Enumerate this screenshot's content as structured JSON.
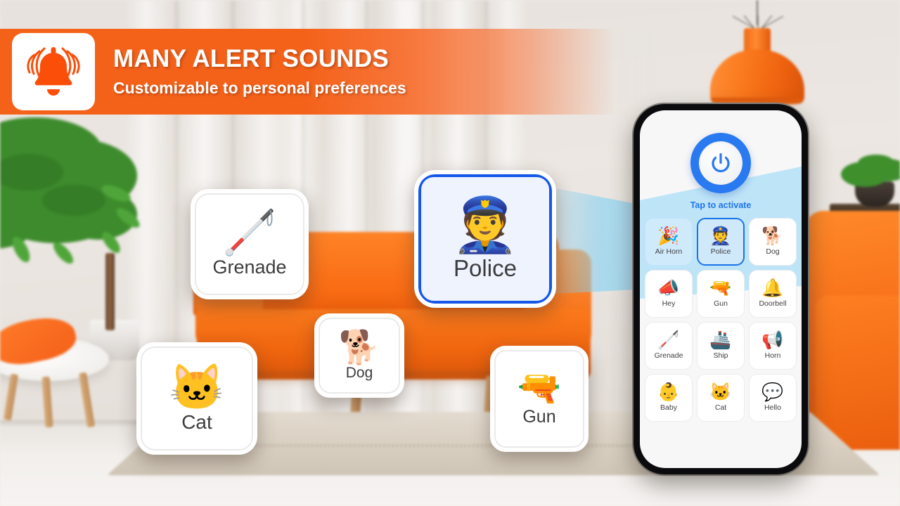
{
  "banner": {
    "icon": "alarm-bell-icon",
    "title": "MANY ALERT SOUNDS",
    "subtitle": "Customizable to personal preferences",
    "bg_color": "#f4621a",
    "text_color": "#ffffff"
  },
  "floating_cards": [
    {
      "id": "grenade",
      "label": "Grenade",
      "emoji": "🦯",
      "icon": "grenade-icon",
      "selected": false
    },
    {
      "id": "police",
      "label": "Police",
      "emoji": "👮",
      "icon": "police-officer-icon",
      "selected": true
    },
    {
      "id": "dog",
      "label": "Dog",
      "emoji": "🐕",
      "icon": "dog-icon",
      "selected": false
    },
    {
      "id": "cat",
      "label": "Cat",
      "emoji": "🐱",
      "icon": "cat-icon",
      "selected": false
    },
    {
      "id": "gun",
      "label": "Gun",
      "emoji": "🔫",
      "icon": "gun-icon",
      "selected": false
    }
  ],
  "phone": {
    "power": {
      "icon": "power-icon",
      "label": "Tap to activate",
      "ring_color": "#2979f0",
      "label_color": "#1f74ef"
    },
    "grid": [
      {
        "label": "Air Horn",
        "emoji": "🎉",
        "icon": "air-horn-icon",
        "selected": false,
        "highlighted": true
      },
      {
        "label": "Police",
        "emoji": "👮",
        "icon": "police-icon",
        "selected": true,
        "highlighted": true
      },
      {
        "label": "Dog",
        "emoji": "🐕",
        "icon": "dog-icon",
        "selected": false,
        "highlighted": false
      },
      {
        "label": "Hey",
        "emoji": "📣",
        "icon": "megaphone-icon",
        "selected": false,
        "highlighted": false
      },
      {
        "label": "Gun",
        "emoji": "🔫",
        "icon": "gun-icon",
        "selected": false,
        "highlighted": false
      },
      {
        "label": "Doorbell",
        "emoji": "🔔",
        "icon": "doorbell-icon",
        "selected": false,
        "highlighted": false
      },
      {
        "label": "Grenade",
        "emoji": "🦯",
        "icon": "grenade-icon",
        "selected": false,
        "highlighted": false
      },
      {
        "label": "Ship",
        "emoji": "🚢",
        "icon": "ship-icon",
        "selected": false,
        "highlighted": false
      },
      {
        "label": "Horn",
        "emoji": "📢",
        "icon": "whistle-icon",
        "selected": false,
        "highlighted": false
      },
      {
        "label": "Baby",
        "emoji": "👶",
        "icon": "baby-icon",
        "selected": false,
        "highlighted": false
      },
      {
        "label": "Cat",
        "emoji": "🐱",
        "icon": "cat-icon",
        "selected": false,
        "highlighted": false
      },
      {
        "label": "Hello",
        "emoji": "💬",
        "icon": "hello-bubble-icon",
        "selected": false,
        "highlighted": false
      }
    ]
  },
  "scene": {
    "description": "living-room-background",
    "accent_orange": "#f4621a",
    "accent_blue": "#1a73e8"
  }
}
